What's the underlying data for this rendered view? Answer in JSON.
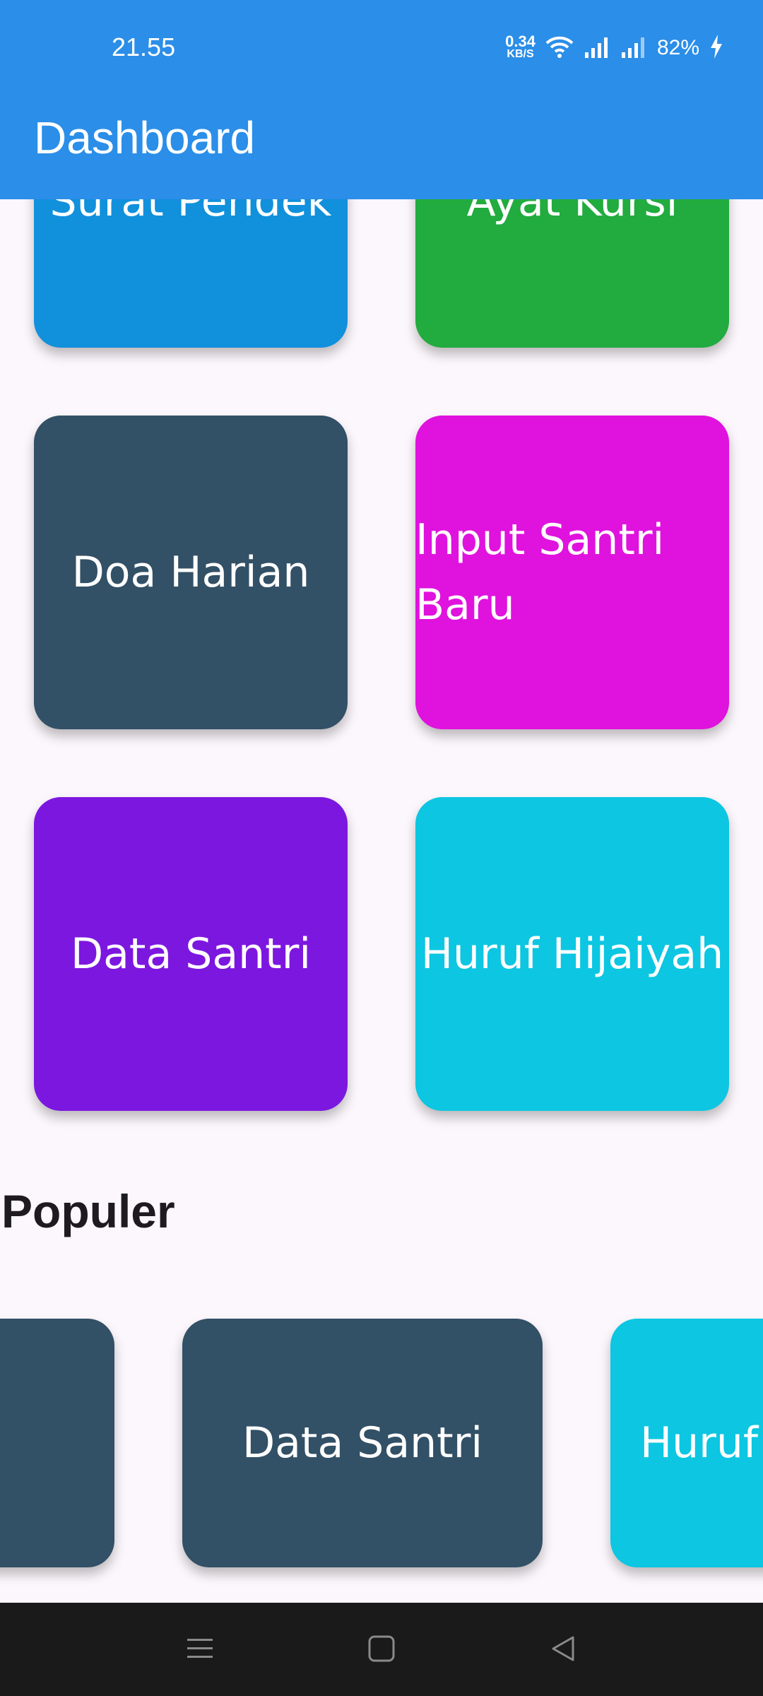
{
  "status_bar": {
    "time": "21.55",
    "net_speed_value": "0.34",
    "net_speed_unit": "KB/S",
    "battery": "82%",
    "icons": [
      "wifi-icon",
      "signal-icon",
      "signal-icon",
      "charging-icon"
    ]
  },
  "app_bar": {
    "title": "Dashboard"
  },
  "menu": {
    "items": [
      {
        "label": "Surat Pendek",
        "color": "#1190dc"
      },
      {
        "label": "Ayat Kursi",
        "color": "#22ab3f"
      },
      {
        "label": "Doa Harian",
        "color": "#325066"
      },
      {
        "label": "Input Santri Baru",
        "color": "#e012de"
      },
      {
        "label": "Data Santri",
        "color": "#7c17e0"
      },
      {
        "label": "Huruf Hijaiyah",
        "color": "#0cc6e2"
      }
    ]
  },
  "popular": {
    "title": "Populer",
    "items": [
      {
        "label": "",
        "color": "#325066"
      },
      {
        "label": "Data Santri",
        "color": "#325066"
      },
      {
        "label": "Huruf Hijaiyah",
        "color": "#0cc6e2"
      }
    ]
  },
  "nav_bar": {
    "icons": [
      "menu-icon",
      "home-icon",
      "back-icon"
    ]
  }
}
